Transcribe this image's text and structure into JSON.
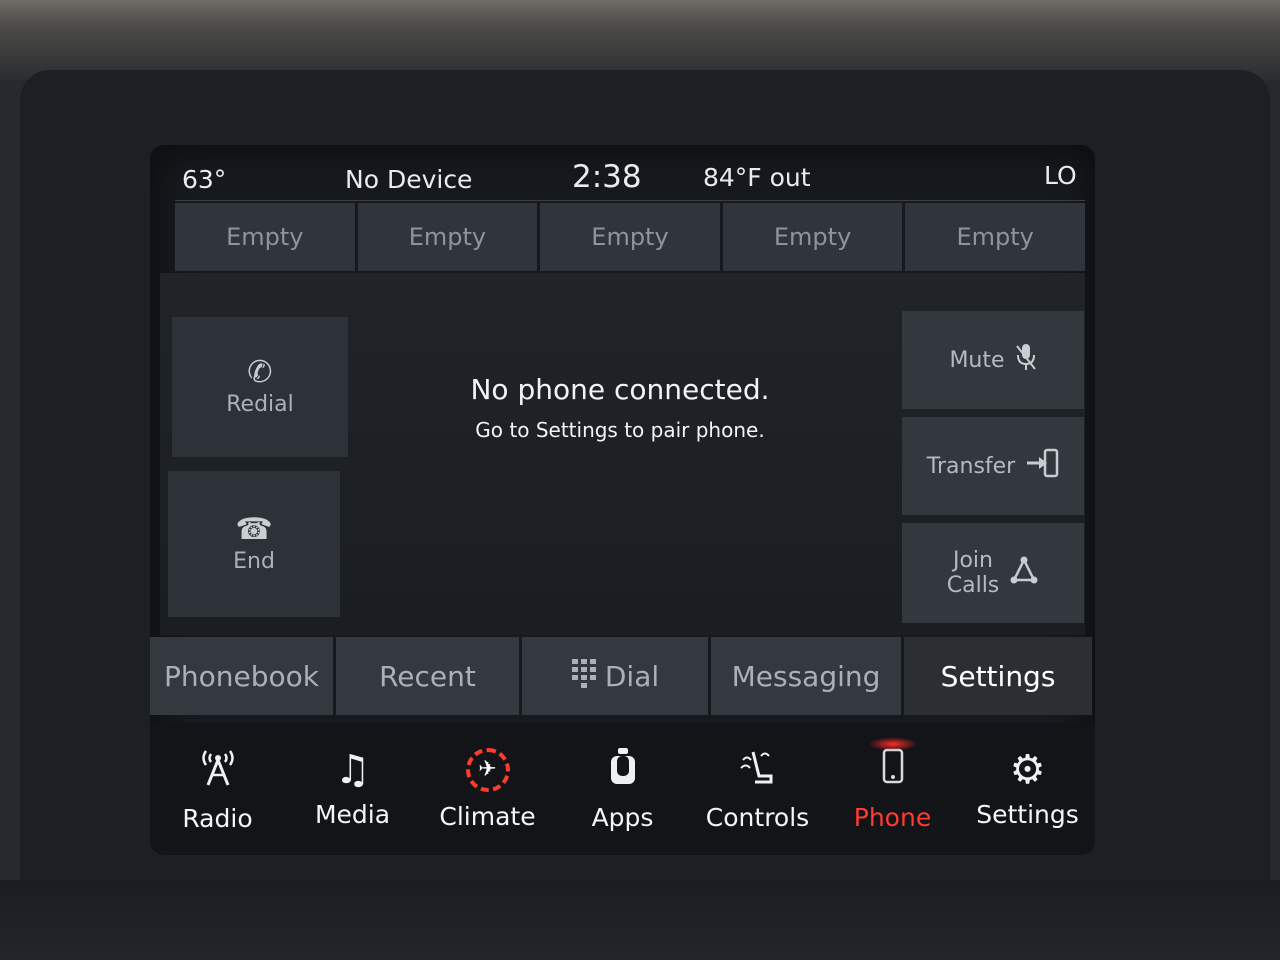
{
  "status": {
    "interior_temp": "63°",
    "device": "No Device",
    "time": "2:38",
    "outside_temp": "84°F out",
    "fan": "LO"
  },
  "favorites": [
    "Empty",
    "Empty",
    "Empty",
    "Empty",
    "Empty"
  ],
  "call_controls": {
    "redial": "Redial",
    "end": "End",
    "mute": "Mute",
    "transfer": "Transfer",
    "join_line1": "Join",
    "join_line2": "Calls"
  },
  "message": {
    "title": "No phone connected.",
    "subtitle": "Go to Settings to pair phone."
  },
  "phone_tabs": {
    "phonebook": "Phonebook",
    "recent": "Recent",
    "dial": "Dial",
    "messaging": "Messaging",
    "settings": "Settings",
    "selected": "Settings"
  },
  "main_nav": {
    "radio": "Radio",
    "media": "Media",
    "climate": "Climate",
    "apps": "Apps",
    "controls": "Controls",
    "phone": "Phone",
    "settings": "Settings",
    "active": "Phone"
  },
  "icons": {
    "redial": "handset-icon",
    "end": "hangup-icon",
    "mute": "mic-off-icon",
    "transfer": "transfer-icon",
    "join": "join-calls-icon",
    "dial": "keypad-icon",
    "radio": "antenna-icon",
    "media": "music-note-icon",
    "climate": "climate-icon",
    "apps": "apps-icon",
    "controls": "seat-controls-icon",
    "phone": "phone-icon",
    "settings": "gear-icon"
  },
  "colors": {
    "active_accent": "#ff3b30",
    "screen_bg": "#16191d",
    "button_bg": "#33383e"
  }
}
